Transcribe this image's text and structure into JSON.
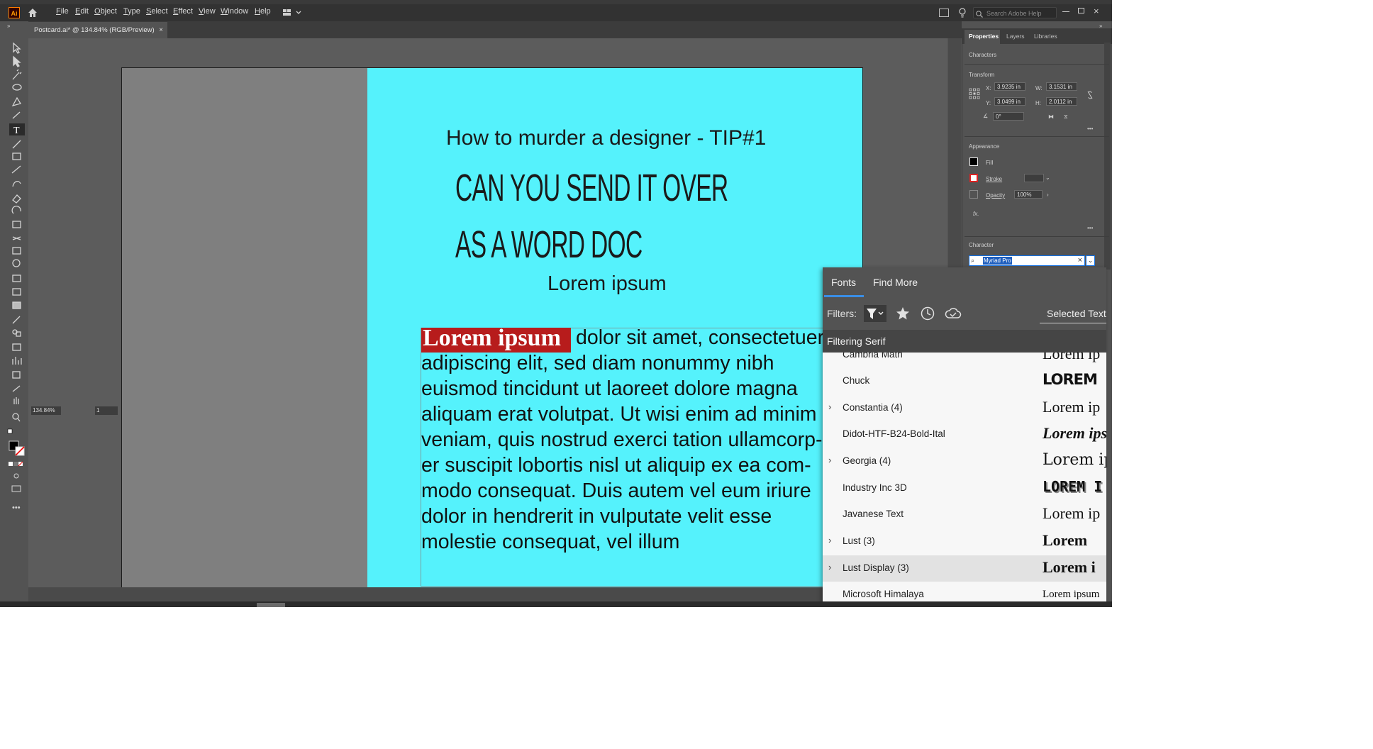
{
  "app": {
    "logo": "Ai"
  },
  "menu": [
    "File",
    "Edit",
    "Object",
    "Type",
    "Select",
    "Effect",
    "View",
    "Window",
    "Help"
  ],
  "search": {
    "placeholder": "Search Adobe Help"
  },
  "document_tab": {
    "title": "Postcard.ai* @ 134.84% (RGB/Preview)",
    "close": "×"
  },
  "status": {
    "zoom": "134.84%",
    "artboard": "1"
  },
  "artwork": {
    "heading": "How to murder a designer - TIP#1",
    "line1": "CAN YOU SEND IT OVER",
    "line2": "AS A WORD DOC",
    "subheading": "Lorem ipsum",
    "selected_text": "Lorem ipsum",
    "body_first": "dolor sit amet, consectetuer",
    "body_lines": [
      "adipiscing elit, sed diam nonummy nibh",
      "euismod tincidunt ut laoreet dolore magna",
      "aliquam erat volutpat. Ut wisi enim ad minim",
      "veniam, quis nostrud exerci tation ullamcorp-",
      "er suscipit lobortis nisl ut aliquip ex ea com-",
      "modo consequat. Duis autem vel eum iriure",
      "dolor in hendrerit in vulputate velit esse",
      "molestie consequat, vel illum"
    ],
    "colors": {
      "artboard": "#55f2fc",
      "highlight": "#b71c1c"
    }
  },
  "properties": {
    "tabs": [
      "Properties",
      "Layers",
      "Libraries"
    ],
    "characters_label": "Characters",
    "transform": {
      "label": "Transform",
      "x_label": "X:",
      "x": "3.9235 in",
      "y_label": "Y:",
      "y": "3.0499 in",
      "w_label": "W:",
      "w": "3.1531 in",
      "h_label": "H:",
      "h": "2.0112 in",
      "angle": "0°"
    },
    "appearance": {
      "label": "Appearance",
      "fill": "Fill",
      "stroke": "Stroke",
      "opacity_label": "Opacity",
      "opacity": "100%",
      "fx": "fx."
    },
    "character": {
      "label": "Character",
      "font": "Myriad Pro"
    },
    "more": "•••"
  },
  "font_panel": {
    "tabs": [
      "Fonts",
      "Find More"
    ],
    "filters_label": "Filters:",
    "selected_text": "Selected Text",
    "filtering": "Filtering Serif",
    "fonts": [
      {
        "name": "Cambria Math",
        "preview": "Lorem ip",
        "expandable": false
      },
      {
        "name": "Chuck",
        "preview": "LOREM",
        "expandable": false
      },
      {
        "name": "Constantia (4)",
        "preview": "Lorem ip",
        "expandable": true
      },
      {
        "name": "Didot-HTF-B24-Bold-Ital",
        "preview": "Lorem ips",
        "expandable": false
      },
      {
        "name": "Georgia (4)",
        "preview": "Lorem ip",
        "expandable": true
      },
      {
        "name": "Industry Inc 3D",
        "preview": "LOREM I",
        "expandable": false
      },
      {
        "name": "Javanese Text",
        "preview": "Lorem ip",
        "expandable": false
      },
      {
        "name": "Lust (3)",
        "preview": "Lorem",
        "expandable": true
      },
      {
        "name": "Lust Display (3)",
        "preview": "Lorem i",
        "expandable": true
      },
      {
        "name": "Microsoft Himalaya",
        "preview": "Lorem ipsum",
        "expandable": false
      }
    ]
  }
}
